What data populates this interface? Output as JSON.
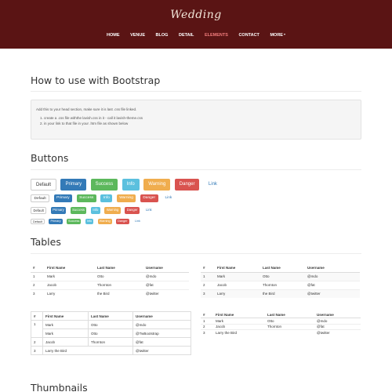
{
  "header": {
    "brand": "Wedding",
    "nav": [
      "HOME",
      "VENUE",
      "BLOG",
      "DETAIL",
      "ELEMENTS",
      "CONTACT",
      "MORE"
    ],
    "active_index": 4,
    "colors": {
      "background": "#5a1414",
      "active": "#f07c7c"
    }
  },
  "bootstrap_section": {
    "title": "How to use with Bootstrap",
    "intro": "Add this to your head section, make sure it is last .css file linked.",
    "steps": [
      "create a .css file withthe lavish.css in it - call it lavish-theme.css",
      "in your link to that file in your .htm file as shown below"
    ]
  },
  "buttons_section": {
    "title": "Buttons",
    "labels": [
      "Default",
      "Primary",
      "Success",
      "Info",
      "Warning",
      "Danger",
      "Link"
    ]
  },
  "tables_section": {
    "title": "Tables",
    "headers": [
      "#",
      "First Name",
      "Last Name",
      "Username"
    ],
    "table_basic": [
      [
        "1",
        "Mark",
        "Otto",
        "@mdo"
      ],
      [
        "2",
        "Jacob",
        "Thornton",
        "@fat"
      ],
      [
        "3",
        "Larry",
        "the Bird",
        "@twitter"
      ]
    ],
    "table_striped": [
      [
        "1",
        "Mark",
        "Otto",
        "@mdo"
      ],
      [
        "2",
        "Jacob",
        "Thornton",
        "@fat"
      ],
      [
        "3",
        "Larry",
        "the Bird",
        "@twitter"
      ]
    ],
    "table_bordered": [
      [
        "1",
        "Mark",
        "Otto",
        "@mdo"
      ],
      [
        "",
        "Mark",
        "Otto",
        "@TwBootstrap"
      ],
      [
        "2",
        "Jacob",
        "Thornton",
        "@fat"
      ],
      [
        "3",
        "Larry the Bird",
        "",
        "@twitter"
      ]
    ],
    "table_condensed": [
      [
        "1",
        "Mark",
        "Otto",
        "@mdo"
      ],
      [
        "2",
        "Jacob",
        "Thornton",
        "@fat"
      ],
      [
        "3",
        "Larry the Bird",
        "",
        "@twitter"
      ]
    ]
  },
  "thumbnails_section": {
    "title": "Thumbnails"
  }
}
